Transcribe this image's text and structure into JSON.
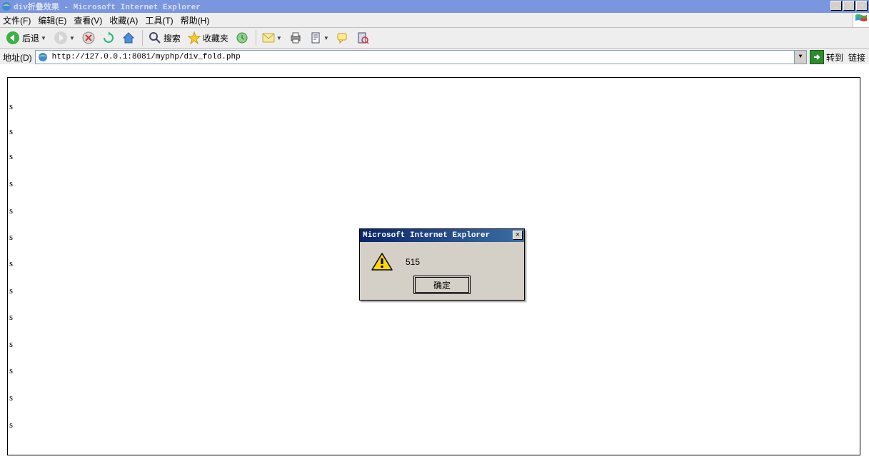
{
  "titlebar": {
    "title": "div折叠效果 - Microsoft Internet Explorer"
  },
  "menu": {
    "file": "文件(F)",
    "edit": "编辑(E)",
    "view": "查看(V)",
    "favorites": "收藏(A)",
    "tools": "工具(T)",
    "help": "帮助(H)"
  },
  "toolbar": {
    "back": "后退",
    "search": "搜索",
    "favorites": "收藏夹"
  },
  "address": {
    "label": "地址(D)",
    "url": "http://127.0.0.1:8081/myphp/div_fold.php",
    "go": "转到",
    "links": "链接"
  },
  "content": {
    "rows": [
      "s",
      "s",
      "s",
      "s",
      "s",
      "s",
      "s",
      "s",
      "s",
      "s",
      "s",
      "s",
      "s"
    ]
  },
  "alert": {
    "title": "Microsoft Internet Explorer",
    "message": "515",
    "ok": "确定"
  }
}
